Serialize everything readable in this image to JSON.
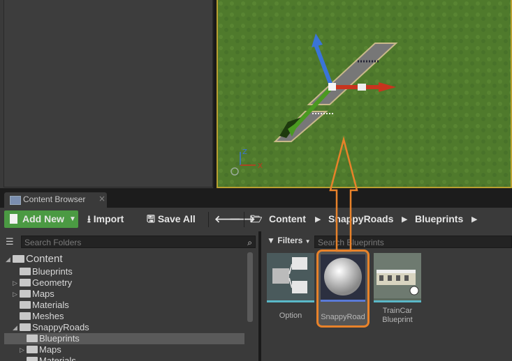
{
  "content_browser_tab": {
    "label": "Content Browser",
    "close": "×"
  },
  "toolbar": {
    "add_new_label": "Add New",
    "import_label": "Import",
    "save_all_label": "Save All"
  },
  "breadcrumb": [
    "Content",
    "SnappyRoads",
    "Blueprints"
  ],
  "folders_panel": {
    "search_placeholder": "Search Folders",
    "tree": [
      {
        "label": "Content"
      },
      {
        "label": "Blueprints"
      },
      {
        "label": "Geometry"
      },
      {
        "label": "Maps"
      },
      {
        "label": "Materials"
      },
      {
        "label": "Meshes"
      },
      {
        "label": "SnappyRoads"
      },
      {
        "label": "Blueprints"
      },
      {
        "label": "Maps"
      },
      {
        "label": "Materials"
      }
    ]
  },
  "assets_panel": {
    "filters_label": "Filters",
    "search_placeholder": "Search Blueprints",
    "assets": [
      {
        "label": "Option"
      },
      {
        "label": "SnappyRoad"
      },
      {
        "label": "TrainCar Blueprint"
      }
    ]
  },
  "viewport": {
    "axis_z": "Z",
    "axis_x": "X"
  },
  "colors": {
    "accent_orange": "#e8822a",
    "add_new_green": "#4b9a43",
    "selection_gold": "#b8a030"
  }
}
